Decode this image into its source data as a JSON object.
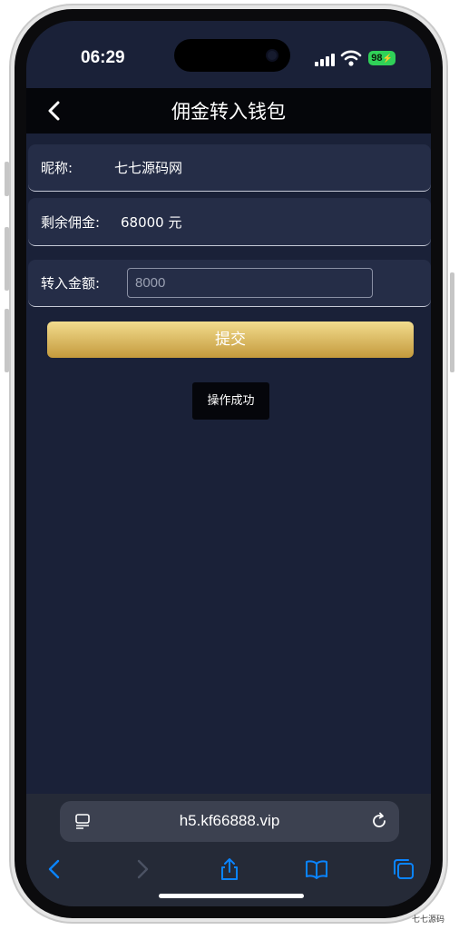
{
  "status": {
    "time": "06:29",
    "battery": "98"
  },
  "nav": {
    "title": "佣金转入钱包"
  },
  "form": {
    "nickname_label": "昵称:",
    "nickname_value": "七七源码网",
    "commission_label": "剩余佣金:",
    "commission_value": "68000 元",
    "amount_label": "转入金额:",
    "amount_placeholder": "8000"
  },
  "submit_label": "提交",
  "toast": "操作成功",
  "browser": {
    "url": "h5.kf66888.vip"
  },
  "watermark": "七七源码",
  "colors": {
    "background": "#1a2138",
    "row": "#252d47",
    "button_top": "#f2dc8e",
    "button_bottom": "#c49a3c",
    "toolbar_icon": "#0a84ff"
  }
}
